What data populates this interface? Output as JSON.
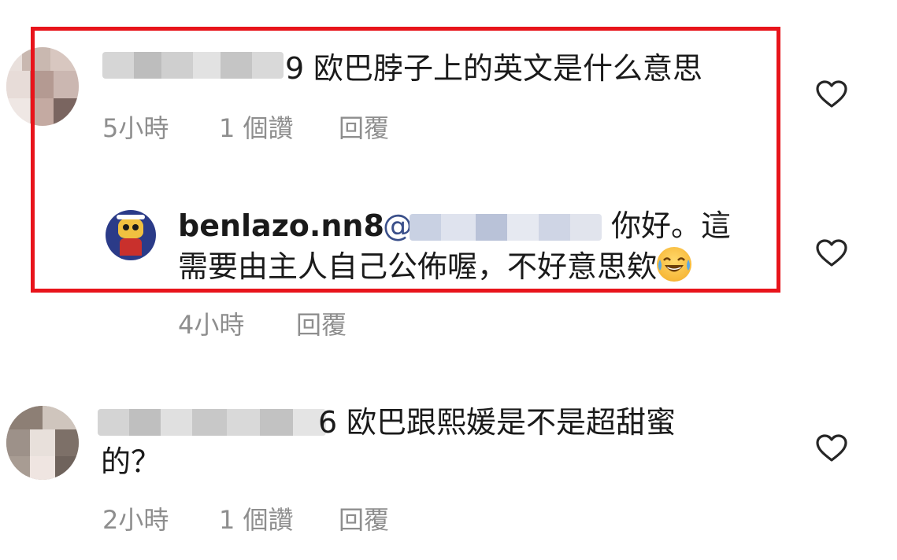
{
  "comments": [
    {
      "username_suffix": "9",
      "text": "欧巴脖子上的英文是什么意思",
      "time": "5小時",
      "likes": "1 個讚",
      "reply": "回覆",
      "like_icon": "heart-outline-icon"
    },
    {
      "username": "benlazo.nn8",
      "mention_prefix": "@",
      "text_line1": "你好。這",
      "text_line2": "需要由主人自己公佈喔，不好意思欸",
      "emoji": "face-with-tears-of-joy-icon",
      "time": "4小時",
      "reply": "回覆",
      "like_icon": "heart-outline-icon"
    },
    {
      "username_suffix": "6",
      "text_line1": "欧巴跟熙媛是不是超甜蜜",
      "text_line2": "的？",
      "time": "2小時",
      "likes": "1 個讚",
      "reply": "回覆",
      "like_icon": "heart-outline-icon"
    }
  ],
  "colors": {
    "highlight": "#e8141b",
    "meta_text": "#8e8e8e",
    "mention": "#3a4f8a",
    "body_text": "#1a1a1a"
  }
}
